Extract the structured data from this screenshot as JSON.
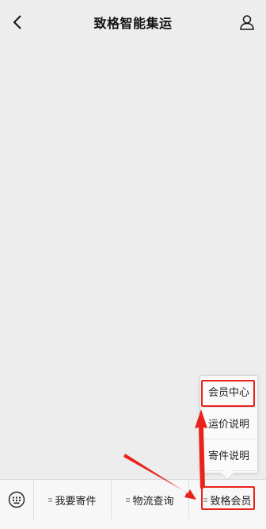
{
  "header": {
    "title": "致格智能集运",
    "back_icon": "chevron-left-icon",
    "profile_icon": "user-icon"
  },
  "popup": {
    "items": [
      {
        "label": "会员中心"
      },
      {
        "label": "运价说明"
      },
      {
        "label": "寄件说明"
      }
    ]
  },
  "menubar": {
    "keyboard_icon": "keyboard-icon",
    "menus": [
      {
        "label": "我要寄件"
      },
      {
        "label": "物流查询"
      },
      {
        "label": "致格会员"
      }
    ]
  },
  "colors": {
    "background": "#ededed",
    "menubar": "#f7f7f7",
    "annotation_red": "#e8231a"
  }
}
